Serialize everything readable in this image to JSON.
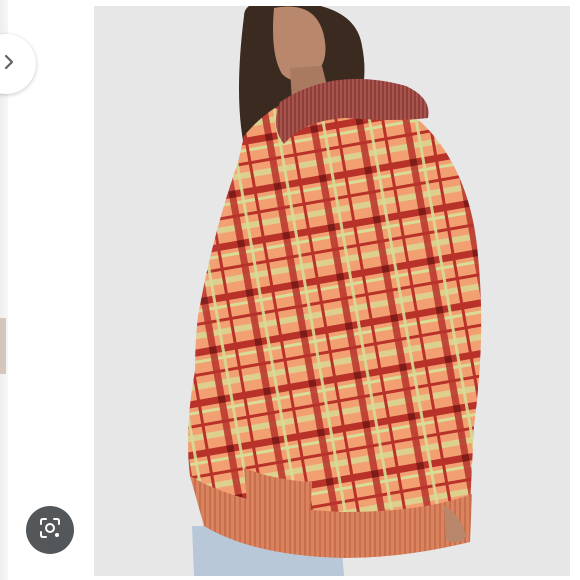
{
  "viewer": {
    "next_control": {
      "icon": "chevron-right-icon"
    },
    "image_search_control": {
      "icon": "lens-icon"
    },
    "photo": {
      "subject": "plaid-cardigan-sweater",
      "colors": {
        "background": "#e7e7e7",
        "sweater_base": "#f2a072",
        "plaid_red": "#b8322a",
        "plaid_green": "#d8dc96",
        "rib_trim": "#d9835f",
        "collar": "#a8534c",
        "hair": "#3a2a20",
        "skin": "#b9876b",
        "jeans": "#b8c8d8"
      }
    }
  }
}
